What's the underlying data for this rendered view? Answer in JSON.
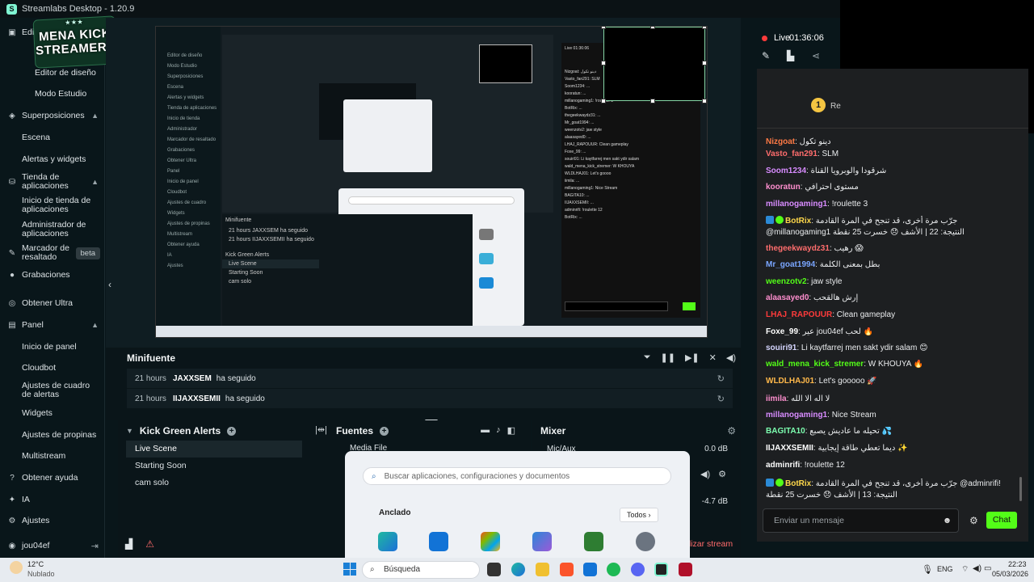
{
  "window": {
    "title": "Streamlabs Desktop - 1.20.9"
  },
  "sidebar": {
    "items": [
      {
        "label": "Editor",
        "icon": "editor-icon"
      },
      {
        "label": "Editor de diseño"
      },
      {
        "label": "Modo Estudio"
      },
      {
        "label": "Superposiciones",
        "icon": "layers-icon"
      },
      {
        "label": "Escena"
      },
      {
        "label": "Alertas y widgets"
      },
      {
        "label": "Tienda de aplicaciones",
        "icon": "store-icon"
      },
      {
        "label": "Inicio de tienda de aplicaciones"
      },
      {
        "label": "Administrador de aplicaciones"
      },
      {
        "label": "Marcador de resaltado",
        "icon": "highlight-icon",
        "badge": "beta"
      },
      {
        "label": "Grabaciones",
        "icon": "record-icon"
      },
      {
        "label": "Obtener Ultra",
        "icon": "ultra-icon"
      },
      {
        "label": "Panel",
        "icon": "panel-icon"
      },
      {
        "label": "Inicio de panel"
      },
      {
        "label": "Cloudbot"
      },
      {
        "label": "Ajustes de cuadro de alertas"
      },
      {
        "label": "Widgets"
      },
      {
        "label": "Ajustes de propinas"
      },
      {
        "label": "Multistream"
      },
      {
        "label": "Obtener ayuda",
        "icon": "help-icon"
      },
      {
        "label": "IA",
        "icon": "ai-icon"
      },
      {
        "label": "Ajustes",
        "icon": "gear-icon"
      }
    ],
    "user": "jou04ef",
    "logo_text": [
      "MENA KICK",
      "STREAMERS"
    ]
  },
  "minifuente": {
    "title": "Minifuente",
    "rows": [
      {
        "time": "21 hours",
        "user": "JAXXSEM",
        "action": "ha seguido"
      },
      {
        "time": "21 hours",
        "user": "IIJAXXSEMII",
        "action": "ha seguido"
      }
    ]
  },
  "scenes": {
    "title": "Kick Green Alerts",
    "items": [
      "Live Scene",
      "Starting Soon",
      "cam solo"
    ],
    "active": "Live Scene"
  },
  "sources": {
    "title": "Fuentes",
    "items": [
      "Media File"
    ]
  },
  "mixer": {
    "title": "Mixer",
    "channels": [
      {
        "name": "Mic/Aux",
        "db": "0.0 dB"
      },
      {
        "db": "-4.7 dB"
      }
    ]
  },
  "bottom": {
    "go_live": "alizar stream"
  },
  "start_menu": {
    "search_placeholder": "Buscar aplicaciones, configuraciones y documentos",
    "pinned": "Anclado",
    "all": "Todos",
    "apps": [
      "Edge",
      "Outlook",
      "Microsoft Store",
      "Photos",
      "Solitaire &",
      "Configuración"
    ]
  },
  "live": {
    "label": "Live",
    "timer": "01:36:06"
  },
  "chat": {
    "header_partial": "Re",
    "messages": [
      {
        "user": "Nizgoat",
        "color": "#ff7a45",
        "text": "دينو تكول"
      },
      {
        "user": "Vasto_fan291",
        "color": "#ff6d6d",
        "text": "SLM"
      },
      {
        "user": "Soom1234",
        "color": "#d88cff",
        "text": "شرقودا والوبرويا القناة"
      },
      {
        "user": "kooratun",
        "color": "#ff8fcf",
        "text": "مستوى احترافي"
      },
      {
        "user": "millanogaming1",
        "color": "#d88cff",
        "text": "!roulette 3"
      },
      {
        "user": "BotRix",
        "color": "#ffd84a",
        "bot": true,
        "text": "جرّب مرة أخرى، قد تنجح في المرة القادمة @millanogaming1 النتيجة: 22 | الأشف 😞 خسرت 25 نقطة"
      },
      {
        "user": "thegeekwaydz31",
        "color": "#ff6d6d",
        "text": "رهيب 😱"
      },
      {
        "user": "Mr_goat1994",
        "color": "#7aa6ff",
        "text": "بطل بمعنى الكلمة"
      },
      {
        "user": "weenzotv2",
        "color": "#53fc18",
        "text": "jaw style"
      },
      {
        "user": "alaasayed0",
        "color": "#ff8fcf",
        "text": "إرش هالقحب"
      },
      {
        "user": "LHAJ_RAPOUUR",
        "color": "#ff3b3b",
        "text": "Clean gameplay"
      },
      {
        "user": "Foxe_99",
        "color": "#ffffff",
        "text": "عير jou04ef لحب 🔥"
      },
      {
        "user": "souiri91",
        "color": "#d6d6ff",
        "text": "Li kaytfarrej men sakt ydir salam 😊"
      },
      {
        "user": "wald_mena_kick_stremer",
        "color": "#53fc18",
        "text": "W KHOUYA 🔥"
      },
      {
        "user": "WLDLHAJ01",
        "color": "#ffb84a",
        "text": "Let's gooooo 🚀"
      },
      {
        "user": "iimila",
        "color": "#ff8fcf",
        "text": "لا اله الا الله"
      },
      {
        "user": "millanogaming1",
        "color": "#d88cff",
        "text": "Nice Stream"
      },
      {
        "user": "BAGITA10",
        "color": "#7dffb0",
        "text": "تحيله ما عاديش يصبع 💦"
      },
      {
        "user": "IIJAXXSEMII",
        "color": "#ffffff",
        "text": "ديما تعطي طاقة إيجابية ✨"
      },
      {
        "user": "adminrifi",
        "color": "#ffffff",
        "text": "!roulette 12"
      },
      {
        "user": "BotRix",
        "color": "#ffd84a",
        "bot": true,
        "text": "جرّب مرة أخرى، قد تنجح في المرة القادمة @adminrifi! النتيجة: 13 | الأشف 😞 خسرت 25 نقطة"
      }
    ],
    "input_placeholder": "Enviar un mensaje",
    "send_label": "Chat"
  },
  "taskbar": {
    "weather_temp": "12°C",
    "weather_desc": "Nublado",
    "search": "Búsqueda",
    "lang": "ENG",
    "time": "22:23",
    "date": "05/03/2026"
  }
}
